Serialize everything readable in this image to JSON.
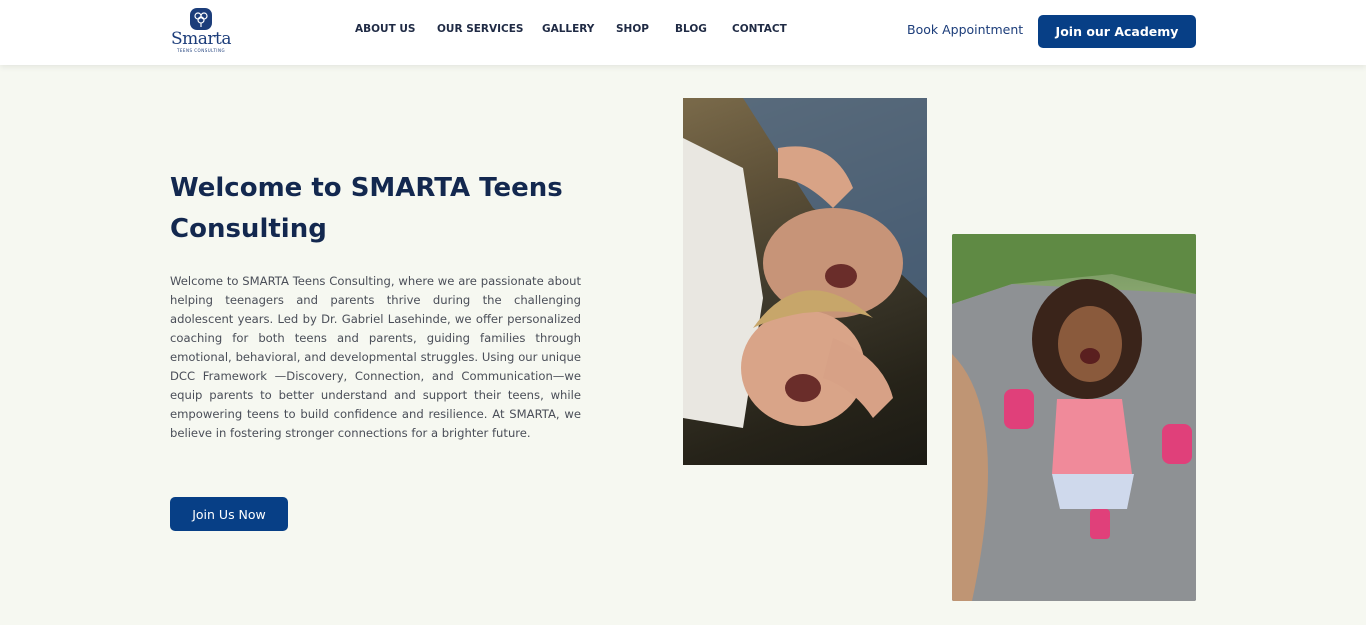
{
  "header": {
    "logo": {
      "name": "Smarta",
      "tagline": "TEENS CONSULTING"
    },
    "nav": [
      {
        "label": "ABOUT US"
      },
      {
        "label": "OUR SERVICES"
      },
      {
        "label": "GALLERY"
      },
      {
        "label": "SHOP"
      },
      {
        "label": "BLOG"
      },
      {
        "label": "CONTACT"
      }
    ],
    "book_link": "Book Appointment",
    "cta_label": "Join our Academy"
  },
  "hero": {
    "title": "Welcome to SMARTA Teens Consulting",
    "body": "Welcome to SMARTA Teens Consulting, where we are passionate about helping teenagers and parents thrive during the challenging adolescent years. Led by Dr. Gabriel Lasehinde, we offer personalized coaching for both teens and parents, guiding families through emotional, behavioral, and developmental struggles. Using our unique DCC Framework —Discovery, Connection, and Communication—we equip parents to better understand and support their teens, while empowering teens to build confidence and resilience. At SMARTA, we believe in fostering stronger connections for a brighter future.",
    "cta_label": "Join Us Now"
  },
  "colors": {
    "page_bg": "#f6f8f1",
    "brand_navy": "#073f86",
    "title_text": "#13284f"
  }
}
